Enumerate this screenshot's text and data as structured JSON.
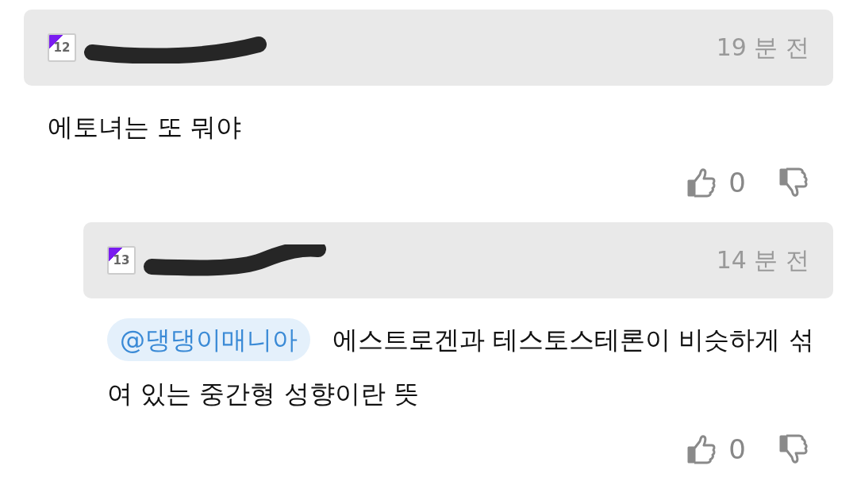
{
  "comments": [
    {
      "level": "12",
      "time": "19 분 전",
      "body": "에토녀는 또 뭐야",
      "likes": "0",
      "children": [
        {
          "level": "13",
          "time": "14 분 전",
          "mention": "@댕댕이매니아",
          "body": "에스트로겐과 테스토스테론이 비슷하게 섞여 있는 중간형 성향이란 뜻",
          "likes": "0"
        }
      ]
    }
  ]
}
